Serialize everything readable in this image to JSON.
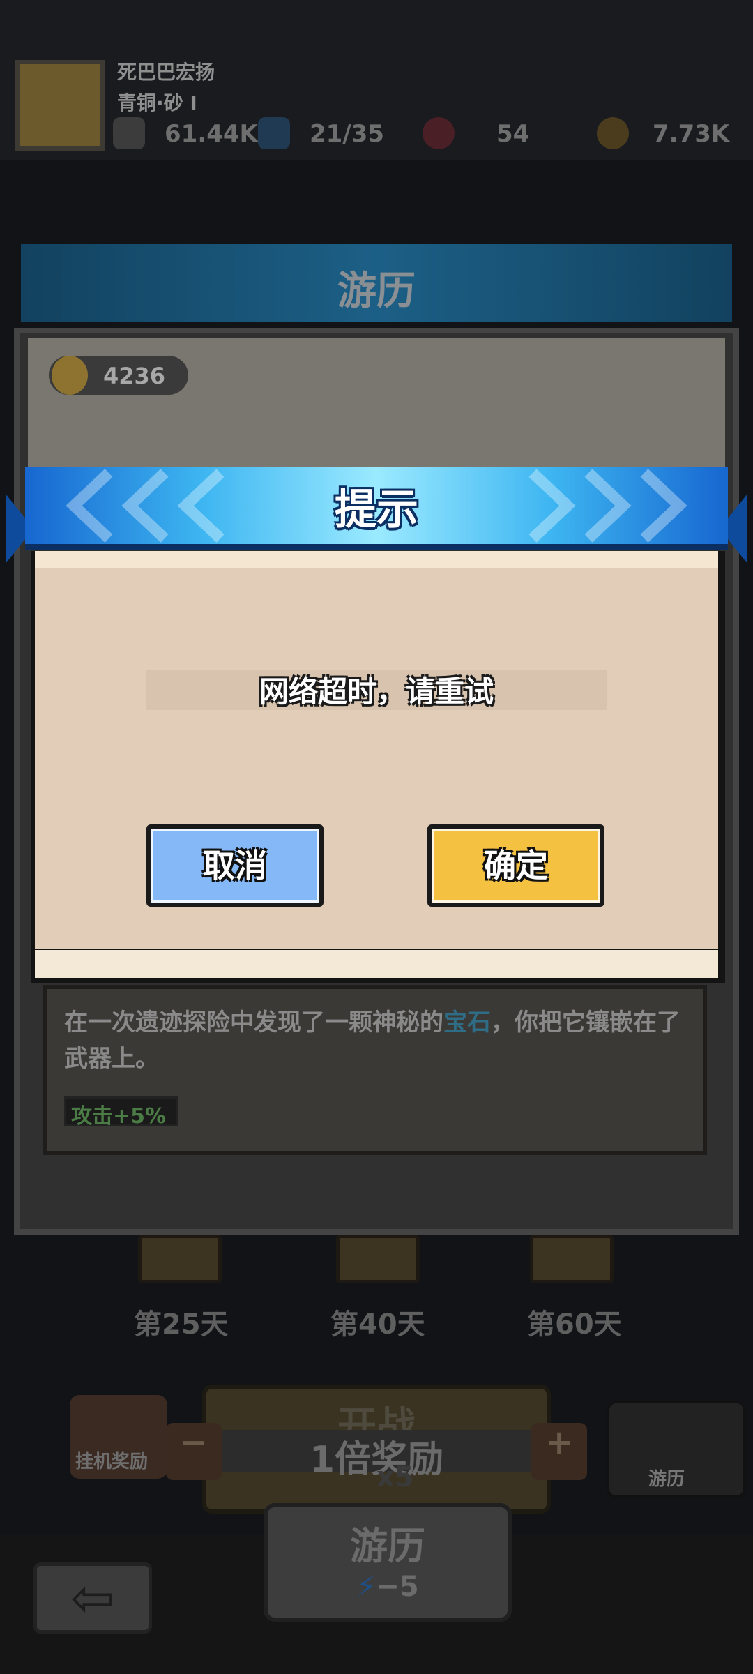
{
  "player": {
    "name": "死巴巴宏扬",
    "title": "青铜·砂 I",
    "stats": [
      {
        "icon": "power-icon",
        "value": "61.44K"
      },
      {
        "icon": "energy-bolt-icon",
        "value": "21/35"
      },
      {
        "icon": "gem-icon",
        "value": "54"
      },
      {
        "icon": "gold-coin-icon",
        "value": "7.73K"
      }
    ]
  },
  "section": {
    "title": "游历",
    "coins": "4236"
  },
  "story": {
    "text_before": "在一次遗迹探险中发现了一颗神秘的",
    "highlight": "宝石",
    "text_after": "，你把它镶嵌在了武器上。",
    "buff": "攻击+5%"
  },
  "milestones": [
    "第25天",
    "第40天",
    "第60天"
  ],
  "bottom": {
    "idle_label": "挂机奖励",
    "battle_label": "开战",
    "reward_label": "1倍奖励",
    "minus": "−",
    "plus": "+",
    "cost_label": "x5",
    "travel_side_label": "游历",
    "travel_label": "游历",
    "travel_cost": "−5"
  },
  "dialog": {
    "title": "提示",
    "message": "网络超时，请重试",
    "cancel_label": "取消",
    "ok_label": "确定"
  },
  "colors": {
    "header_blue": "#3db5f1",
    "dialog_body": "#e1cdb8",
    "cancel_blue": "#85b8f7",
    "confirm_yellow": "#f5c140"
  }
}
